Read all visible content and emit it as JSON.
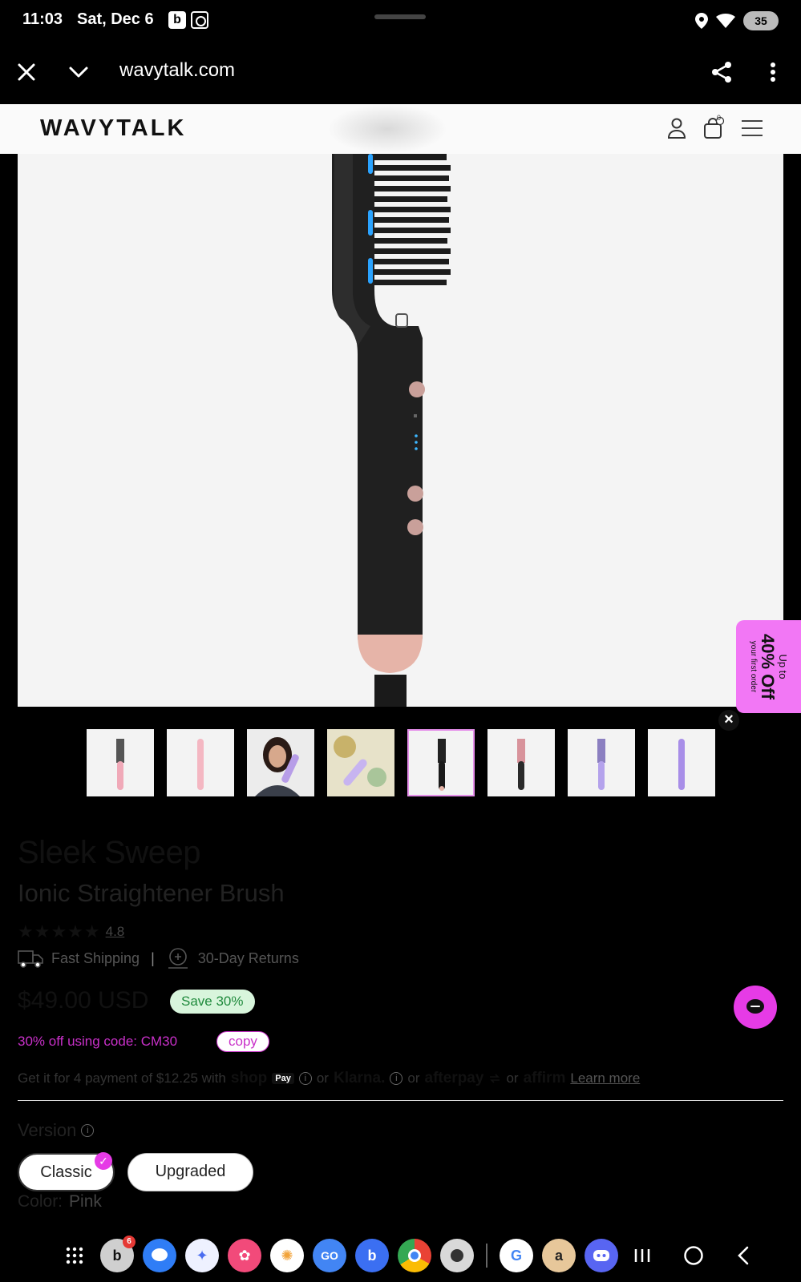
{
  "status_bar": {
    "time": "11:03",
    "date": "Sat, Dec 6",
    "battery": "35"
  },
  "browser": {
    "url": "wavytalk.com"
  },
  "site": {
    "logo": "WAVYTALK",
    "cart_count": "0"
  },
  "promo": {
    "line1": "Up to",
    "line2": "40% Off",
    "line3": "your first order"
  },
  "thumbnails": [
    {
      "name": "thumb-1",
      "color": "#f0a9b8"
    },
    {
      "name": "thumb-2",
      "color": "#f4b7c2"
    },
    {
      "name": "thumb-3",
      "color": "#b79de8"
    },
    {
      "name": "thumb-4",
      "color": "#c7b4f0"
    },
    {
      "name": "thumb-5",
      "color": "#1a1a1a"
    },
    {
      "name": "thumb-6",
      "color": "#d8939b"
    },
    {
      "name": "thumb-7",
      "color": "#b4a2ec"
    },
    {
      "name": "thumb-8",
      "color": "#a88ee8"
    }
  ],
  "product": {
    "title": "Sleek Sweep",
    "subtitle": "Ionic Straightener Brush",
    "stars": "★★★★★",
    "rating": "4.8",
    "benefit_shipping": "Fast Shipping",
    "benefit_sep": "|",
    "benefit_returns": "30-Day Returns",
    "price": "$49.00 USD",
    "save_badge": "Save 30%",
    "promo_code_text": "30% off using code: CM30",
    "copy_label": "copy",
    "payment_prefix": "Get it for 4 payment of $12.25 with",
    "shop_brand": "shop",
    "shop_pay_box": "Pay",
    "or1": "or",
    "klarna": "Klarna.",
    "or2": "or",
    "afterpay": "afterpay",
    "or3": "or",
    "affirm": "affirm",
    "learn_more": "Learn more",
    "version_label": "Version",
    "version_options": [
      "Classic",
      "Upgraded"
    ],
    "color_label": "Color:",
    "color_value": "Pink"
  },
  "colors": {
    "accent_pink": "#e63be6",
    "promo_pink": "#f277f5",
    "save_green_bg": "#d8f5dc",
    "save_green_text": "#1f8a3c"
  },
  "dock": {
    "apps": [
      {
        "name": "app-drawer-icon",
        "label": "⋮⋮⋮",
        "bg": "#000"
      },
      {
        "name": "booking-app-icon",
        "label": "b",
        "bg": "#cfcfcf",
        "badge": "6"
      },
      {
        "name": "messages-app-icon",
        "label": "",
        "bg": "#2f7df6"
      },
      {
        "name": "gemini-app-icon",
        "label": "✦",
        "bg": "#4a6cf0"
      },
      {
        "name": "flower-app-icon",
        "label": "✿",
        "bg": "#f24a7a"
      },
      {
        "name": "photos-app-icon",
        "label": "✺",
        "bg": "#ffffff"
      },
      {
        "name": "go-app-icon",
        "label": "GO",
        "bg": "#4285f4"
      },
      {
        "name": "bluesky-app-icon",
        "label": "b",
        "bg": "#3b6ff2"
      },
      {
        "name": "chrome-app-icon",
        "label": "",
        "bg": "#e94235"
      },
      {
        "name": "camera-app-icon",
        "label": "",
        "bg": "#d9d9d9"
      },
      {
        "name": "google-app-icon",
        "label": "G",
        "bg": "#ffffff"
      },
      {
        "name": "amazon-app-icon",
        "label": "a",
        "bg": "#e7c79a"
      },
      {
        "name": "discord-app-icon",
        "label": "",
        "bg": "#5865f2"
      }
    ]
  }
}
